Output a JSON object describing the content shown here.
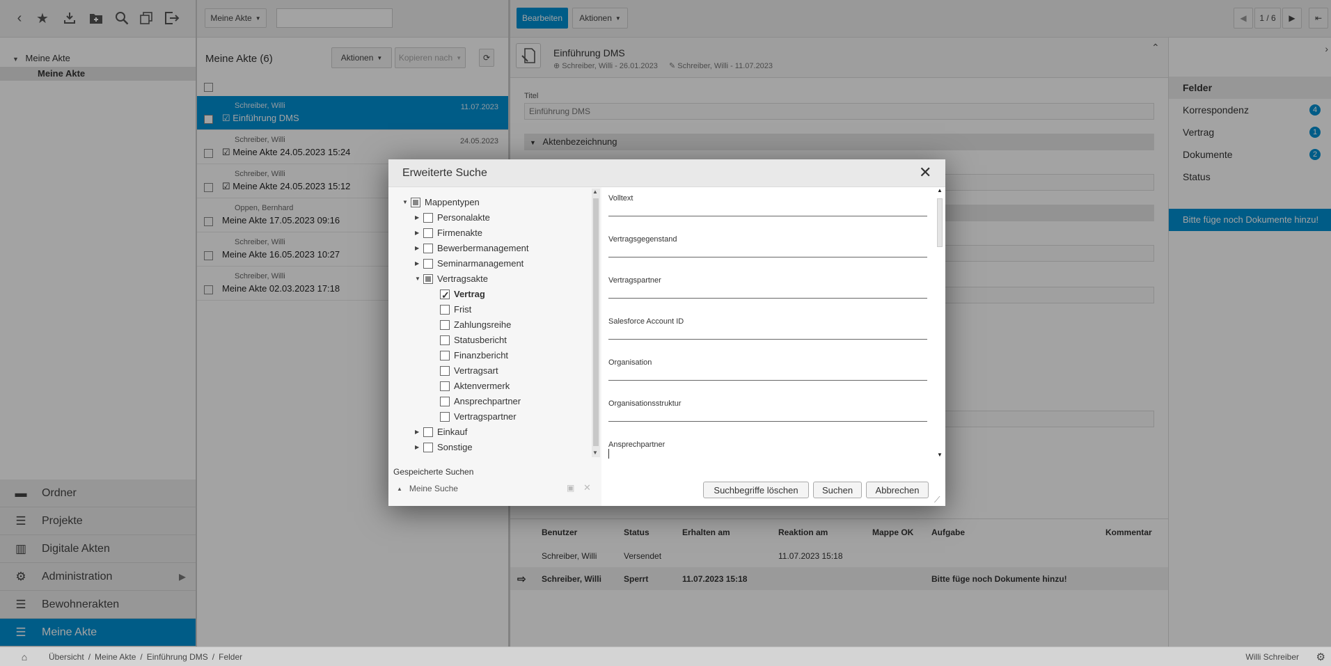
{
  "toolbar_left": {
    "icons": [
      "back-icon",
      "star-icon",
      "download-icon",
      "new-folder-icon",
      "search-icon",
      "copy-icon",
      "logout-icon"
    ]
  },
  "tree": {
    "root": "Meine Akte",
    "child": "Meine Akte"
  },
  "nav": {
    "items": [
      {
        "label": "Ordner",
        "icon": "folder-icon"
      },
      {
        "label": "Projekte",
        "icon": "list-icon"
      },
      {
        "label": "Digitale Akten",
        "icon": "map-icon"
      },
      {
        "label": "Administration",
        "icon": "gear-icon"
      },
      {
        "label": "Bewohnerakten",
        "icon": "list-icon"
      },
      {
        "label": "Meine Akte",
        "icon": "list-icon"
      }
    ],
    "administration_arrow": "▶"
  },
  "breadcrumb": {
    "items": [
      "Übersicht",
      "Meine Akte",
      "Einführung DMS",
      "Felder"
    ],
    "user": "Willi Schreiber"
  },
  "middle": {
    "dropdown_label": "Meine Akte",
    "search_placeholder": "",
    "list_title": "Meine Akte (6)",
    "actions_label": "Aktionen",
    "copy_label": "Kopieren nach",
    "items": [
      {
        "author": "Schreiber, Willi",
        "title": "Einführung DMS",
        "date": "11.07.2023",
        "selected": true,
        "task": true
      },
      {
        "author": "Schreiber, Willi",
        "title": "Meine Akte 24.05.2023 15:24",
        "date": "24.05.2023",
        "selected": false,
        "task": true
      },
      {
        "author": "Schreiber, Willi",
        "title": "Meine Akte 24.05.2023 15:12",
        "date": "",
        "selected": false,
        "task": true
      },
      {
        "author": "Oppen, Bernhard",
        "title": "Meine Akte 17.05.2023 09:16",
        "date": "",
        "selected": false,
        "task": false
      },
      {
        "author": "Schreiber, Willi",
        "title": "Meine Akte 16.05.2023 10:27",
        "date": "",
        "selected": false,
        "task": false
      },
      {
        "author": "Schreiber, Willi",
        "title": "Meine Akte 02.03.2023 17:18",
        "date": "",
        "selected": false,
        "task": false
      }
    ]
  },
  "right": {
    "edit_label": "Bearbeiten",
    "actions_label": "Aktionen",
    "pager": "1 / 6",
    "doc_title": "Einführung DMS",
    "created": "Schreiber, Willi - 26.01.2023",
    "modified": "Schreiber, Willi - 11.07.2023",
    "title_label": "Titel",
    "title_value": "Einführung DMS",
    "section_label": "Aktenbezeichnung"
  },
  "fields_panel": {
    "header": "Felder",
    "items": [
      {
        "label": "Korrespondenz",
        "count": "4"
      },
      {
        "label": "Vertrag",
        "count": "1"
      },
      {
        "label": "Dokumente",
        "count": "2"
      },
      {
        "label": "Status",
        "count": ""
      }
    ],
    "notice": "Bitte füge noch Dokumente hinzu!"
  },
  "table": {
    "headers": [
      "Benutzer",
      "Status",
      "Erhalten am",
      "Reaktion am",
      "Mappe OK",
      "Aufgabe",
      "Kommentar"
    ],
    "rows": [
      {
        "user": "Schreiber, Willi",
        "status": "Versendet",
        "received": "",
        "reaction": "11.07.2023 15:18",
        "ok": "",
        "task": "",
        "comment": ""
      },
      {
        "user": "Schreiber, Willi",
        "status": "Sperrt",
        "received": "11.07.2023 15:18",
        "reaction": "",
        "ok": "",
        "task": "Bitte füge noch Dokumente hinzu!",
        "comment": ""
      }
    ]
  },
  "dialog": {
    "title": "Erweiterte Suche",
    "tree": {
      "root": "Mappentypen",
      "nodes": [
        "Personalakte",
        "Firmenakte",
        "Bewerbermanagement",
        "Seminarmanagement",
        "Vertragsakte"
      ],
      "children": [
        "Vertrag",
        "Frist",
        "Zahlungsreihe",
        "Statusbericht",
        "Finanzbericht",
        "Vertragsart",
        "Aktenvermerk",
        "Ansprechpartner",
        "Vertragspartner"
      ],
      "after": [
        "Einkauf",
        "Sonstige"
      ]
    },
    "saved_searches_label": "Gespeicherte Suchen",
    "saved_search_item": "Meine Suche",
    "fields": [
      "Volltext",
      "Vertragsgegenstand",
      "Vertragspartner",
      "Salesforce Account ID",
      "Organisation",
      "Organisationsstruktur",
      "Ansprechpartner"
    ],
    "buttons": {
      "clear": "Suchbegriffe löschen",
      "search": "Suchen",
      "cancel": "Abbrechen"
    }
  }
}
